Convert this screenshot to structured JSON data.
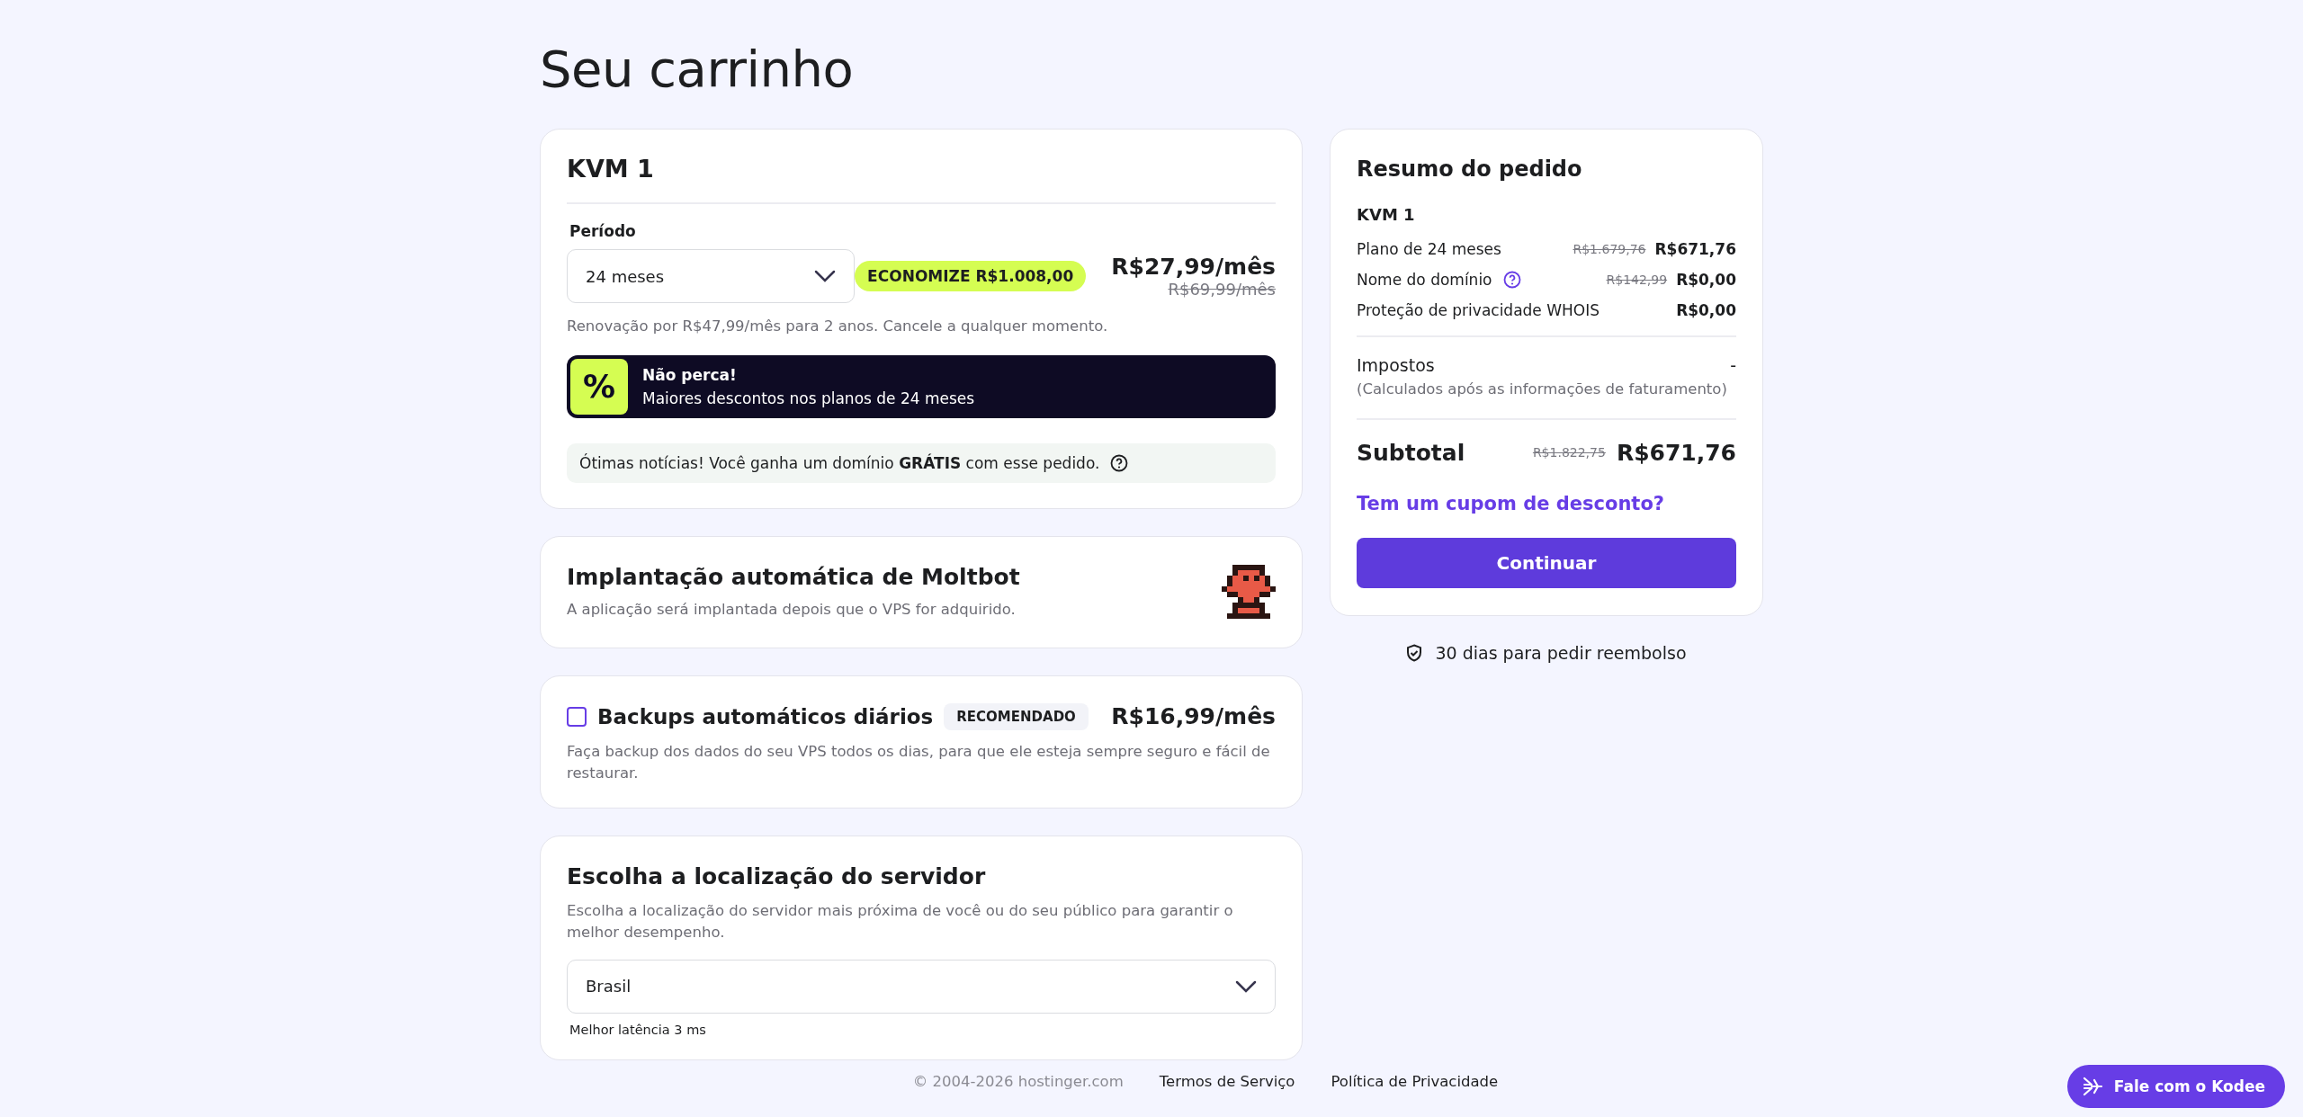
{
  "title": "Seu carrinho",
  "plan": {
    "name": "KVM 1",
    "period_label": "Período",
    "period_value": "24 meses",
    "savings_badge": "ECONOMIZE R$1.008,00",
    "price": "R$27,99/mês",
    "old_price": "R$69,99/mês",
    "renewal_note": "Renovação por R$47,99/mês para 2 anos. Cancele a qualquer momento.",
    "promo": {
      "symbol": "%",
      "title": "Não perca!",
      "text": "Maiores descontos nos planos de 24 meses"
    },
    "domain_note": "Ótimas notícias! Você ganha um domínio **GRÁTIS** com esse pedido."
  },
  "moltbot": {
    "title": "Implantação automática de Moltbot",
    "description": "A aplicação será implantada depois que o VPS for adquirido."
  },
  "backups": {
    "checked": false,
    "title": "Backups automáticos diários",
    "badge": "RECOMENDADO",
    "price": "R$16,99/mês",
    "description": "Faça backup dos dados do seu VPS todos os dias, para que ele esteja sempre seguro e fácil de restaurar."
  },
  "location": {
    "title": "Escolha a localização do servidor",
    "description": "Escolha a localização do servidor mais próxima de você ou do seu público para garantir o melhor desempenho.",
    "value": "Brasil",
    "latency": "Melhor latência 3 ms"
  },
  "summary": {
    "title": "Resumo do pedido",
    "product": "KVM 1",
    "lines": [
      {
        "label": "Plano de 24 meses",
        "old_price": "R$1.679,76",
        "price": "R$671,76",
        "help": false
      },
      {
        "label": "Nome do domínio",
        "old_price": "R$142,99",
        "price": "R$0,00",
        "help": true
      },
      {
        "label": "Proteção de privacidade WHOIS",
        "price": "R$0,00",
        "help": false
      }
    ],
    "taxes_label": "Impostos",
    "taxes_value": "-",
    "taxes_note": "(Calculados após as informações de faturamento)",
    "subtotal_label": "Subtotal",
    "subtotal_old": "R$1.822,75",
    "subtotal": "R$671,76",
    "coupon_link": "Tem um cupom de desconto?",
    "continue_button": "Continuar"
  },
  "refund_note": "30 dias para pedir reembolso",
  "footer": {
    "copyright": "© 2004-2026 hostinger.com",
    "links": [
      "Termos de Serviço",
      "Política de Privacidade"
    ]
  },
  "chat_button": "Fale com o Kodee"
}
